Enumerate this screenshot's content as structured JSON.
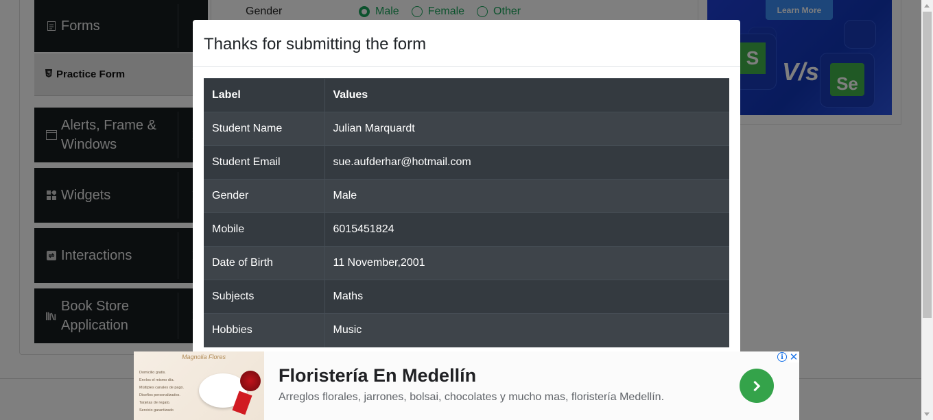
{
  "sidebar": {
    "groups": [
      {
        "label": "Forms",
        "icon": "document-icon"
      },
      {
        "label": "Alerts, Frame & Windows",
        "icon": "window-icon"
      },
      {
        "label": "Widgets",
        "icon": "widgets-icon"
      },
      {
        "label": "Interactions",
        "icon": "interactions-icon"
      },
      {
        "label": "Book Store Application",
        "icon": "library-icon"
      }
    ],
    "active_item": "Practice Form"
  },
  "form_background": {
    "gender_label": "Gender",
    "gender_options": [
      "Male",
      "Female",
      "Other"
    ],
    "gender_selected": "Male",
    "accent_color": "#28a745"
  },
  "top_ad": {
    "cta": "Learn More",
    "s_glyph": "S",
    "vs_glyph": "V/s",
    "se_glyph": "Se"
  },
  "modal": {
    "title": "Thanks for submitting the form",
    "table": {
      "headers": [
        "Label",
        "Values"
      ],
      "rows": [
        {
          "label": "Student Name",
          "value": "Julian Marquardt"
        },
        {
          "label": "Student Email",
          "value": "sue.aufderhar@hotmail.com"
        },
        {
          "label": "Gender",
          "value": "Male"
        },
        {
          "label": "Mobile",
          "value": "6015451824"
        },
        {
          "label": "Date of Birth",
          "value": "11 November,2001"
        },
        {
          "label": "Subjects",
          "value": "Maths"
        },
        {
          "label": "Hobbies",
          "value": "Music"
        }
      ]
    }
  },
  "bottom_ad": {
    "brand": "Magnolia Flores",
    "services": [
      "Domicilio gratis.",
      "Envíos el mismo día.",
      "Múltiples canales de pago.",
      "Diseños personalizados.",
      "Tarjetas de regalo.",
      "Servicio garantizado"
    ],
    "title": "Floristería En Medellín",
    "description": "Arreglos florales, jarrones, bolsai, chocolates y mucho mas, floristería Medellín.",
    "info_glyph": "i",
    "close_glyph": "✕"
  }
}
